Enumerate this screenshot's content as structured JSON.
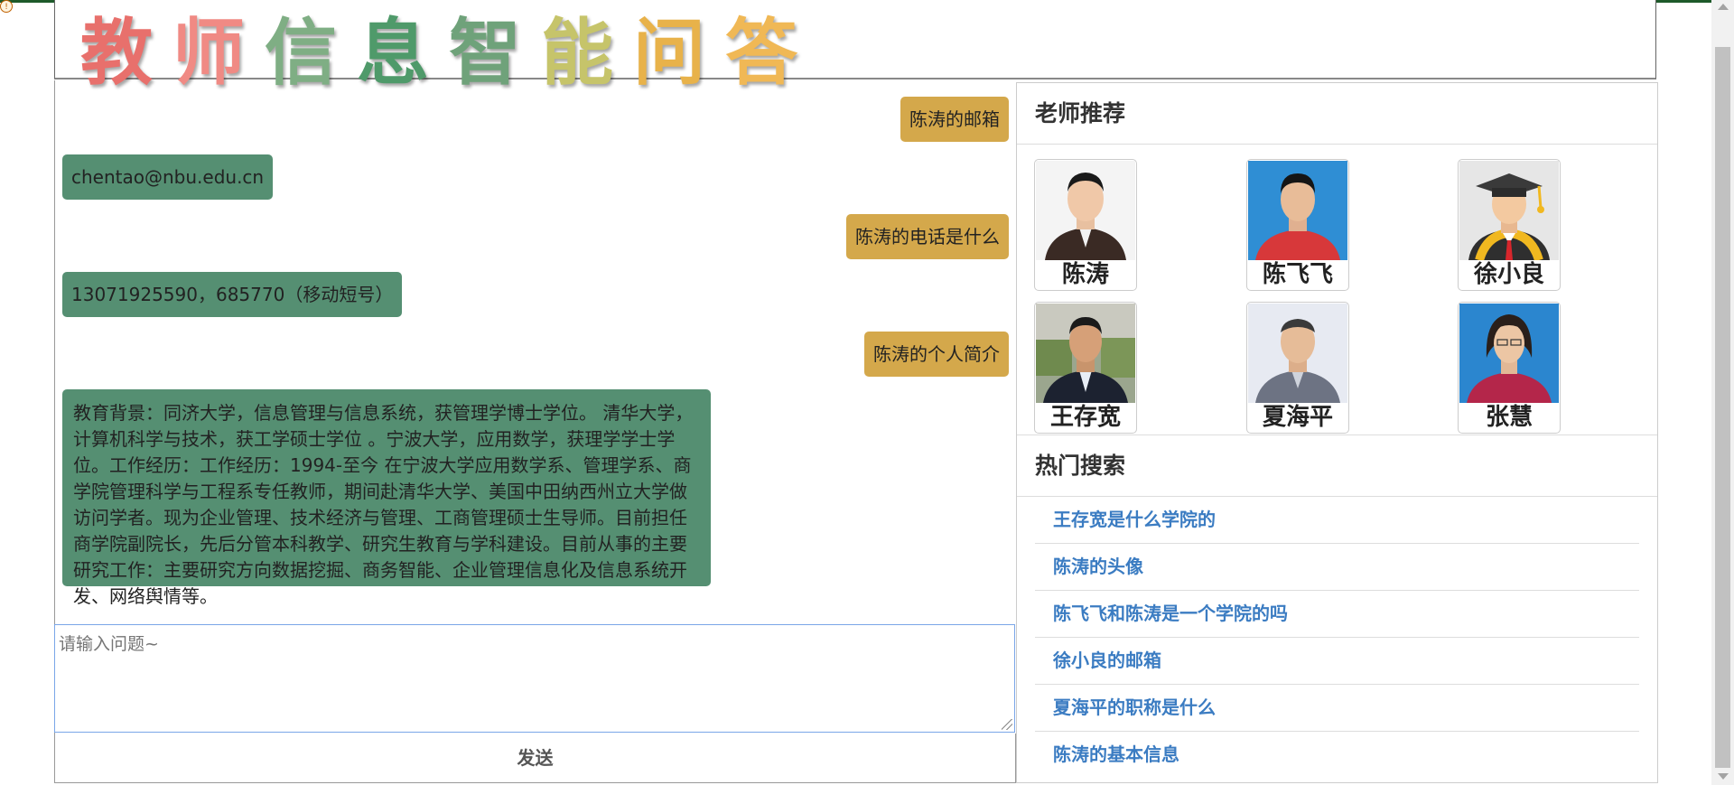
{
  "header": {
    "logo_chars": [
      "教",
      "师",
      "信",
      "息",
      "智",
      "能",
      "问",
      "答"
    ],
    "logo_colors": [
      "#e8706c",
      "#f08a84",
      "#7fae84",
      "#4f9a6a",
      "#6fa27a",
      "#c6c46a",
      "#e8b24a",
      "#f0b855"
    ]
  },
  "chat": {
    "messages": [
      {
        "role": "question",
        "text": "陈涛的邮箱"
      },
      {
        "role": "answer",
        "text": "chentao@nbu.edu.cn"
      },
      {
        "role": "question",
        "text": "陈涛的电话是什么"
      },
      {
        "role": "answer",
        "text": "13071925590，685770（移动短号）"
      },
      {
        "role": "question",
        "text": "陈涛的个人简介"
      },
      {
        "role": "answer",
        "text": "教育背景：同济大学，信息管理与信息系统，获管理学博士学位。 清华大学，计算机科学与技术，获工学硕士学位 。宁波大学，应用数学，获理学学士学位。工作经历：工作经历：1994-至今 在宁波大学应用数学系、管理学系、商学院管理科学与工程系专任教师，期间赴清华大学、美国中田纳西州立大学做访问学者。现为企业管理、技术经济与管理、工商管理硕士生导师。目前担任商学院副院长，先后分管本科教学、研究生教育与学科建设。目前从事的主要研究工作：主要研究方向数据挖掘、商务智能、企业管理信息化及信息系统开发、网络舆情等。"
      }
    ],
    "input_placeholder": "请输入问题~",
    "send_label": "发送",
    "question_color": "#d4a84b",
    "answer_color": "#558f72"
  },
  "sidebar": {
    "teachers_title": "老师推荐",
    "teachers": [
      {
        "name": "陈涛",
        "photo": "portrait-photo"
      },
      {
        "name": "陈飞飞",
        "photo": "portrait-photo"
      },
      {
        "name": "徐小良",
        "photo": "graduate-avatar-icon"
      },
      {
        "name": "王存宽",
        "photo": "portrait-photo"
      },
      {
        "name": "夏海平",
        "photo": "portrait-photo"
      },
      {
        "name": "张慧",
        "photo": "portrait-photo"
      }
    ],
    "hot_title": "热门搜索",
    "hot_searches": [
      "王存宽是什么学院的",
      "陈涛的头像",
      "陈飞飞和陈涛是一个学院的吗",
      "徐小良的邮箱",
      "夏海平的职称是什么",
      "陈涛的基本信息"
    ],
    "link_color": "#3b7cc2"
  }
}
